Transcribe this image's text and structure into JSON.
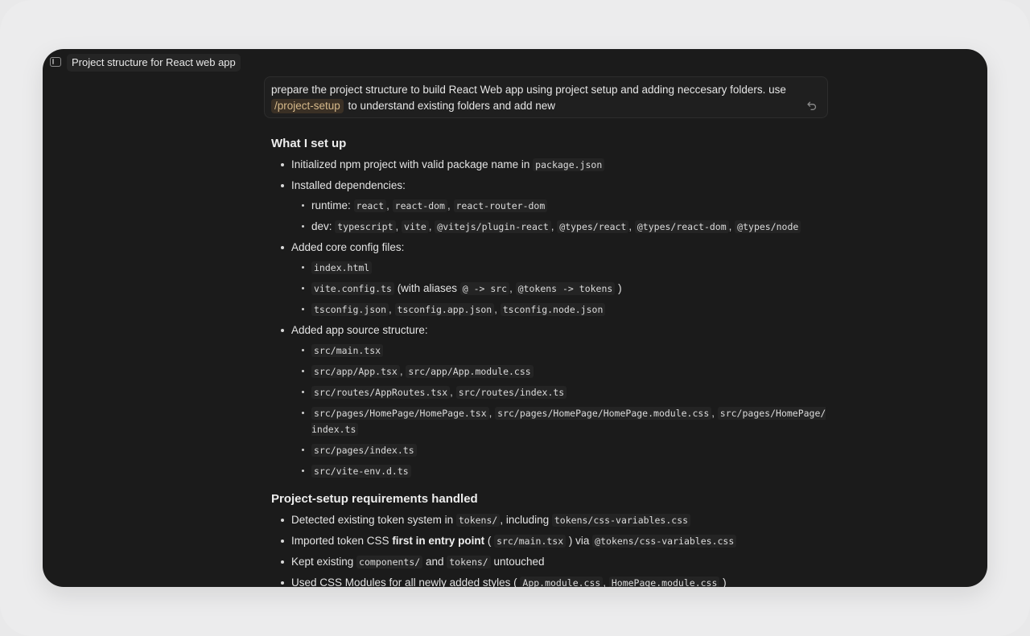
{
  "window": {
    "title": "Project structure for React web app"
  },
  "prompt": {
    "text_before": "prepare the project structure to build React Web app using project setup and adding neccesary folders. use ",
    "command": "/project-setup",
    "text_after": " to understand existing folders and add new"
  },
  "section1": {
    "heading": "What I set up",
    "item1_text": "Initialized npm project with valid package name in ",
    "item1_code": "package.json",
    "item2_text": "Installed dependencies:",
    "runtime_label": "runtime: ",
    "runtime_codes": [
      "react",
      "react-dom",
      "react-router-dom"
    ],
    "dev_label": "dev: ",
    "dev_codes": [
      "typescript",
      "vite",
      "@vitejs/plugin-react",
      "@types/react",
      "@types/react-dom",
      "@types/node"
    ],
    "item3_text": "Added core config files:",
    "config_index": "index.html",
    "config_vite": "vite.config.ts",
    "config_vite_note": " (with aliases ",
    "alias1": "@ -> src",
    "alias2": "@tokens -> tokens",
    "config_vite_close": " )",
    "config_ts_codes": [
      "tsconfig.json",
      "tsconfig.app.json",
      "tsconfig.node.json"
    ],
    "item4_text": "Added app source structure:",
    "src_main": "src/main.tsx",
    "src_app_codes": [
      "src/app/App.tsx",
      "src/app/App.module.css"
    ],
    "src_routes_codes": [
      "src/routes/AppRoutes.tsx",
      "src/routes/index.ts"
    ],
    "src_pages_codes": [
      "src/pages/HomePage/HomePage.tsx",
      "src/pages/HomePage/HomePage.module.css",
      "src/pages/HomePage/index.ts"
    ],
    "src_pages_index": "src/pages/index.ts",
    "src_env": "src/vite-env.d.ts"
  },
  "section2": {
    "heading": "Project-setup requirements handled",
    "r1_a": "Detected existing token system in ",
    "r1_code1": "tokens/",
    "r1_b": ", including ",
    "r1_code2": "tokens/css-variables.css",
    "r2_a": "Imported token CSS ",
    "r2_bold": "first in entry point",
    "r2_b": " ( ",
    "r2_code1": "src/main.tsx",
    "r2_c": " ) via ",
    "r2_code2": "@tokens/css-variables.css",
    "r3_a": "Kept existing ",
    "r3_code1": "components/",
    "r3_b": " and ",
    "r3_code2": "tokens/",
    "r3_c": " untouched",
    "r4_a": "Used CSS Modules for all newly added styles ( ",
    "r4_code1": "App.module.css",
    "r4_code2": "HomePage.module.css",
    "r4_c": " )"
  },
  "colors": {
    "window_bg": "#1b1b1b",
    "page_bg": "#ececed",
    "command_chip_bg": "#3a3025",
    "command_chip_text": "#d6b98a"
  },
  "icons": {
    "sidebar": "sidebar-toggle-icon",
    "undo": "undo-icon"
  }
}
